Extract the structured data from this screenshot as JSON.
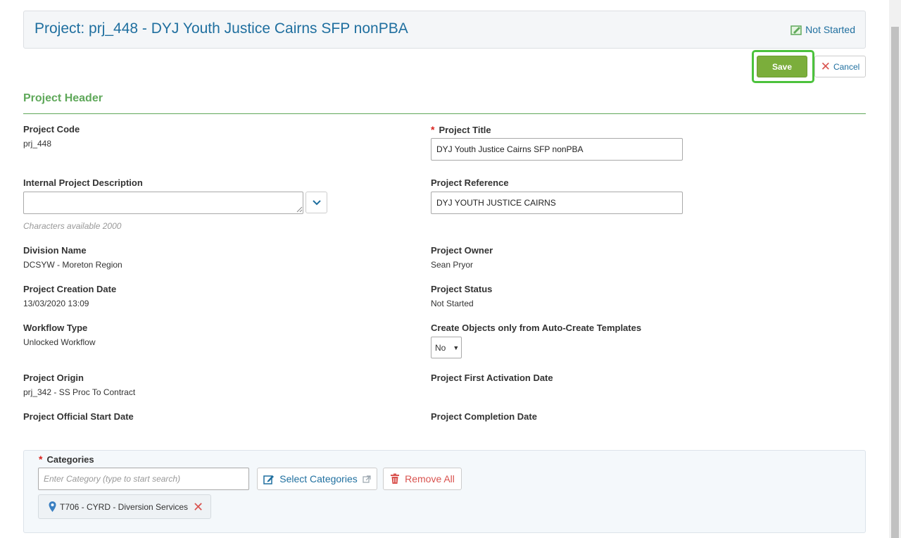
{
  "header": {
    "title": "Project: prj_448 - DYJ Youth Justice Cairns SFP nonPBA",
    "status": "Not Started"
  },
  "actions": {
    "save_label": "Save",
    "cancel_label": "Cancel"
  },
  "section": {
    "title": "Project Header"
  },
  "fields": {
    "project_code": {
      "label": "Project Code",
      "value": "prj_448"
    },
    "project_title": {
      "label": "Project Title",
      "value": "DYJ Youth Justice Cairns SFP nonPBA"
    },
    "internal_description": {
      "label": "Internal Project Description",
      "value": "",
      "hint": "Characters available 2000"
    },
    "project_reference": {
      "label": "Project Reference",
      "value": "DYJ YOUTH JUSTICE CAIRNS"
    },
    "division_name": {
      "label": "Division Name",
      "value": "DCSYW - Moreton Region"
    },
    "project_owner": {
      "label": "Project Owner",
      "value": "Sean Pryor"
    },
    "creation_date": {
      "label": "Project Creation Date",
      "value": "13/03/2020 13:09"
    },
    "project_status": {
      "label": "Project Status",
      "value": "Not Started"
    },
    "workflow_type": {
      "label": "Workflow Type",
      "value": "Unlocked Workflow"
    },
    "auto_create": {
      "label": "Create Objects only from Auto-Create Templates",
      "value": "No"
    },
    "project_origin": {
      "label": "Project Origin",
      "value": "prj_342 - SS Proc To Contract"
    },
    "first_activation": {
      "label": "Project First Activation Date",
      "value": ""
    },
    "official_start": {
      "label": "Project Official Start Date",
      "value": ""
    },
    "completion_date": {
      "label": "Project Completion Date",
      "value": ""
    }
  },
  "categories": {
    "label": "Categories",
    "placeholder": "Enter Category (type to start search)",
    "select_label": "Select Categories",
    "remove_all_label": "Remove All",
    "items": [
      {
        "label": "T706 - CYRD - Diversion Services"
      }
    ]
  },
  "colors": {
    "accent_blue": "#1f6f9f",
    "section_green": "#5fa85a",
    "save_green": "#7bae3b",
    "highlight_green": "#4cc23c",
    "danger_red": "#d9534f"
  }
}
